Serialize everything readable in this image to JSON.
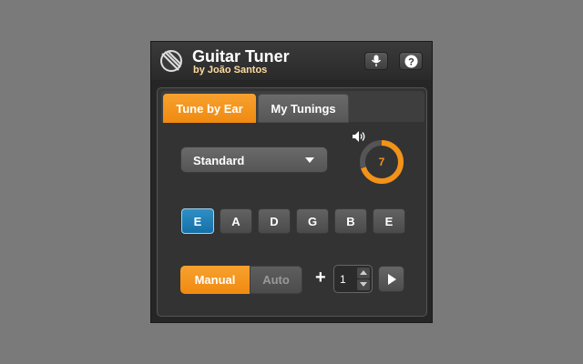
{
  "header": {
    "title": "Guitar Tuner",
    "subtitle": "by João Santos",
    "icons": [
      "guitar-icon",
      "microphone-icon",
      "help-icon"
    ]
  },
  "tabs": [
    {
      "label": "Tune by Ear",
      "active": true
    },
    {
      "label": "My Tunings",
      "active": false
    }
  ],
  "tuning": {
    "selected": "Standard"
  },
  "volume": {
    "value": "7",
    "level": 0.7
  },
  "strings": [
    {
      "label": "E",
      "active": true
    },
    {
      "label": "A",
      "active": false
    },
    {
      "label": "D",
      "active": false
    },
    {
      "label": "G",
      "active": false
    },
    {
      "label": "B",
      "active": false
    },
    {
      "label": "E",
      "active": false
    }
  ],
  "mode": {
    "manual_label": "Manual",
    "auto_label": "Auto",
    "selected": "Manual"
  },
  "repeat": {
    "plus_label": "+",
    "count": "1"
  },
  "colors": {
    "accent": "#f08a10",
    "active_string": "#1670a8"
  }
}
